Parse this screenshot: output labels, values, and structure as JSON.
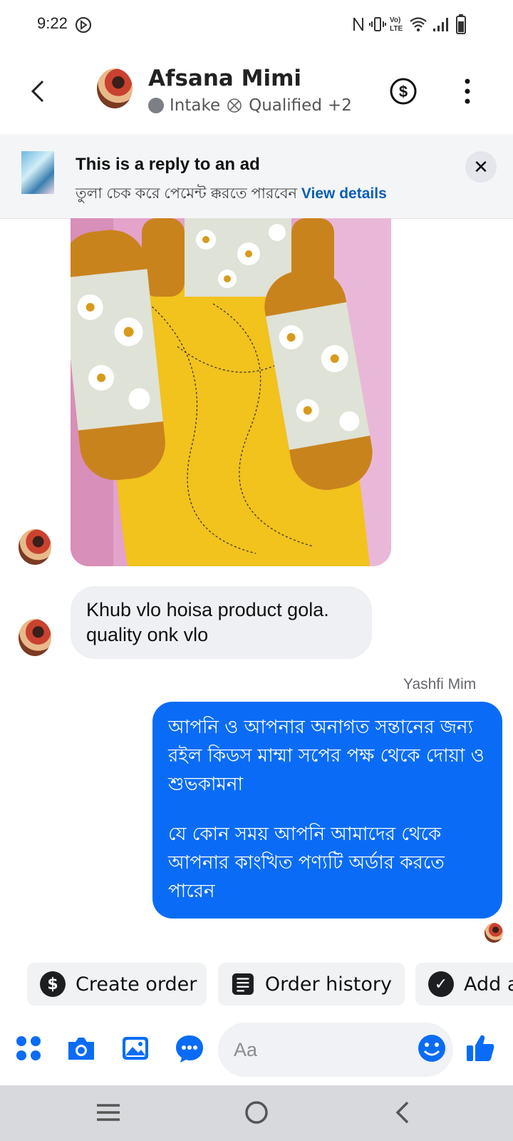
{
  "status_bar": {
    "time": "9:22"
  },
  "header": {
    "name": "Afsana Mimi",
    "tag_intake": "Intake",
    "tag_qualified": "Qualified",
    "tag_more": "+2"
  },
  "ad_banner": {
    "title": "This is a reply to an ad",
    "subtitle": "তুলা চেক করে  পেমেন্ট  ক্করতে পারবেন",
    "link": "View details"
  },
  "messages": {
    "incoming_text": "Khub vlo hoisa product gola. quality onk vlo",
    "sender_name": "Yashfi Mim",
    "outgoing_p1": "আপনি ও আপনার অনাগত সন্তানের জন্য রইল কিডস মাম্মা সপের পক্ষ থেকে দোয়া ও শুভকামনা",
    "outgoing_p2": "যে কোন সময় আপনি আমাদের থেকে আপনার কাংখিত পণ্যটি অর্ডার করতে পারেন"
  },
  "quick_actions": [
    {
      "label": "Create order",
      "icon": "dollar-icon"
    },
    {
      "label": "Order history",
      "icon": "receipt-icon"
    },
    {
      "label": "Add a",
      "icon": "check-icon"
    }
  ],
  "composer": {
    "placeholder": "Aa"
  },
  "colors": {
    "accent": "#0a6cf6",
    "bubble_in": "#eef0f3",
    "banner": "#f4f5f7"
  }
}
